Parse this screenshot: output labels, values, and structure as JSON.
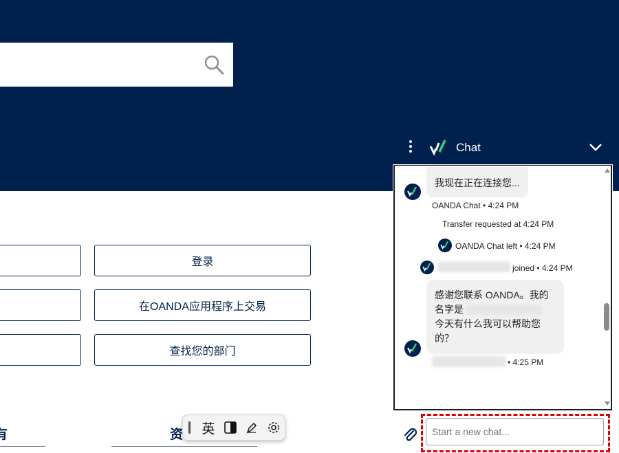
{
  "search": {
    "placeholder": ""
  },
  "options": {
    "left": [
      "",
      "",
      ""
    ],
    "right": [
      "登录",
      "在OANDA应用程序上交易",
      "查找您的部门"
    ]
  },
  "bottom": {
    "left_fragment": "有",
    "mid_fragment": "资"
  },
  "ime_toolbar": {
    "mode_char": "英"
  },
  "chat": {
    "title": "Chat",
    "messages": {
      "connecting_text": "我现在正在连接您...",
      "bot_meta": "OANDA Chat • 4:24 PM",
      "transfer_note": "Transfer requested at 4:24 PM",
      "left_note": "OANDA Chat left • 4:24 PM",
      "joined_suffix": "joined • 4:24 PM",
      "agent_line1": "感谢您联系 OANDA。我的",
      "agent_line2_prefix": "名字是",
      "agent_line3": "今天有什么我可以帮助您",
      "agent_line4": "的？",
      "agent_meta_suffix": "• 4:25 PM"
    },
    "composer": {
      "placeholder": "Start a new chat..."
    }
  },
  "colors": {
    "brand_navy": "#00214d",
    "brand_green": "#3ccb7f",
    "highlight_red": "#e00000"
  }
}
